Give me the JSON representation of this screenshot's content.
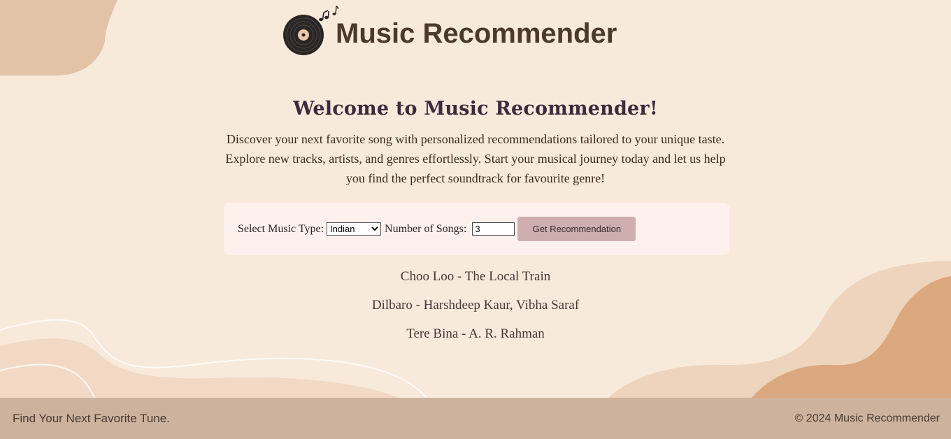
{
  "header": {
    "title": "Music Recommender"
  },
  "welcome": {
    "heading": "Welcome to Music Recommender!",
    "line1": "Discover your next favorite song with personalized recommendations tailored to your unique taste.",
    "line2": "Explore new tracks, artists, and genres effortlessly. Start your musical journey today and let us help",
    "line3": "you find the perfect soundtrack for favourite genre!"
  },
  "form": {
    "music_type_label": "Select Music Type:",
    "music_type_value": "Indian",
    "num_songs_label": "Number of Songs:",
    "num_songs_value": "3",
    "button_label": "Get Recommendation"
  },
  "results": [
    "Choo Loo - The Local Train",
    "Dilbaro - Harshdeep Kaur, Vibha Saraf",
    "Tere Bina - A. R. Rahman"
  ],
  "footer": {
    "tagline": "Find Your Next Favorite Tune.",
    "copyright": "© 2024 Music Recommender"
  },
  "colors": {
    "background": "#f8eadb",
    "footer": "#cdb29e",
    "button": "#cfaeaf",
    "title": "#4b3a2c"
  }
}
